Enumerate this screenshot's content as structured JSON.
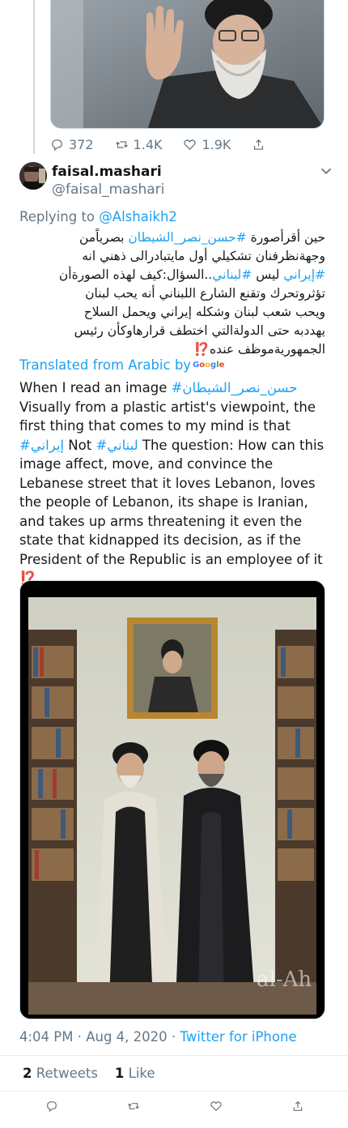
{
  "top_tweet": {
    "replies": "372",
    "retweets": "1.4K",
    "likes": "1.9K"
  },
  "author": {
    "name": "faisal.mashari",
    "handle": "@faisal_mashari"
  },
  "reply": {
    "prefix": "Replying to ",
    "to": "@Alshaikh2"
  },
  "arabic": {
    "l1a": "حين أقرأصورة ",
    "l1tag": "#حسن_نصر_الشيطان",
    "l1b": " بصرياًمن",
    "l2": "وجهةنظرفنان تشكيلي أول مايتبادرالى ذهني انه",
    "l3tag1": "#إيراني",
    "l3a": " ليس ",
    "l3tag2": "#لبناني",
    "l3b": "..السؤال:كيف لهذه الصورةأن",
    "l4": "تؤثروتحرك وتقنع الشارع اللبناني أنه يحب لبنان",
    "l5": "ويحب شعب لبنان وشكله إيراني ويحمل السلاح",
    "l6": "يهددبه حتى الدولةالتي اختطف قرارهاوكأن رئيس",
    "l7": "الجمهوريةموظف عنده",
    "emoji": "⁉️"
  },
  "translation": {
    "label": "Translated from Arabic by",
    "provider": "Google"
  },
  "english": {
    "p1": "When I read an image ",
    "tag1": "#حسن_نصر_الشيطان",
    "p2": " Visually from a plastic artist's viewpoint, the first thing that comes to my mind is that ",
    "tag2": "#إيراني",
    "p3": " Not ",
    "tag3": "#لبناني",
    "p4": " The question: How can this image affect, move, and convince the Lebanese street that it loves Lebanon, loves the people of Lebanon, its shape is Iranian, and takes up arms threatening it even the state that kidnapped its decision, as if the President of the Republic is an employee of it ",
    "emoji": "⁉️"
  },
  "meta": {
    "time": "4:04 PM · Aug 4, 2020",
    "dot": " · ",
    "source": "Twitter for iPhone"
  },
  "stats": {
    "retweets_count": "2",
    "retweets_label": " Retweets",
    "likes_count": "1",
    "likes_label": " Like"
  },
  "watermark": "al-Ah",
  "icons": [
    "reply-icon",
    "retweet-icon",
    "like-icon",
    "share-icon",
    "chevron-down-icon"
  ],
  "colors": {
    "link": "#1da1f2",
    "secondary": "#657786",
    "text": "#14171a",
    "border": "#ccd6dd"
  }
}
